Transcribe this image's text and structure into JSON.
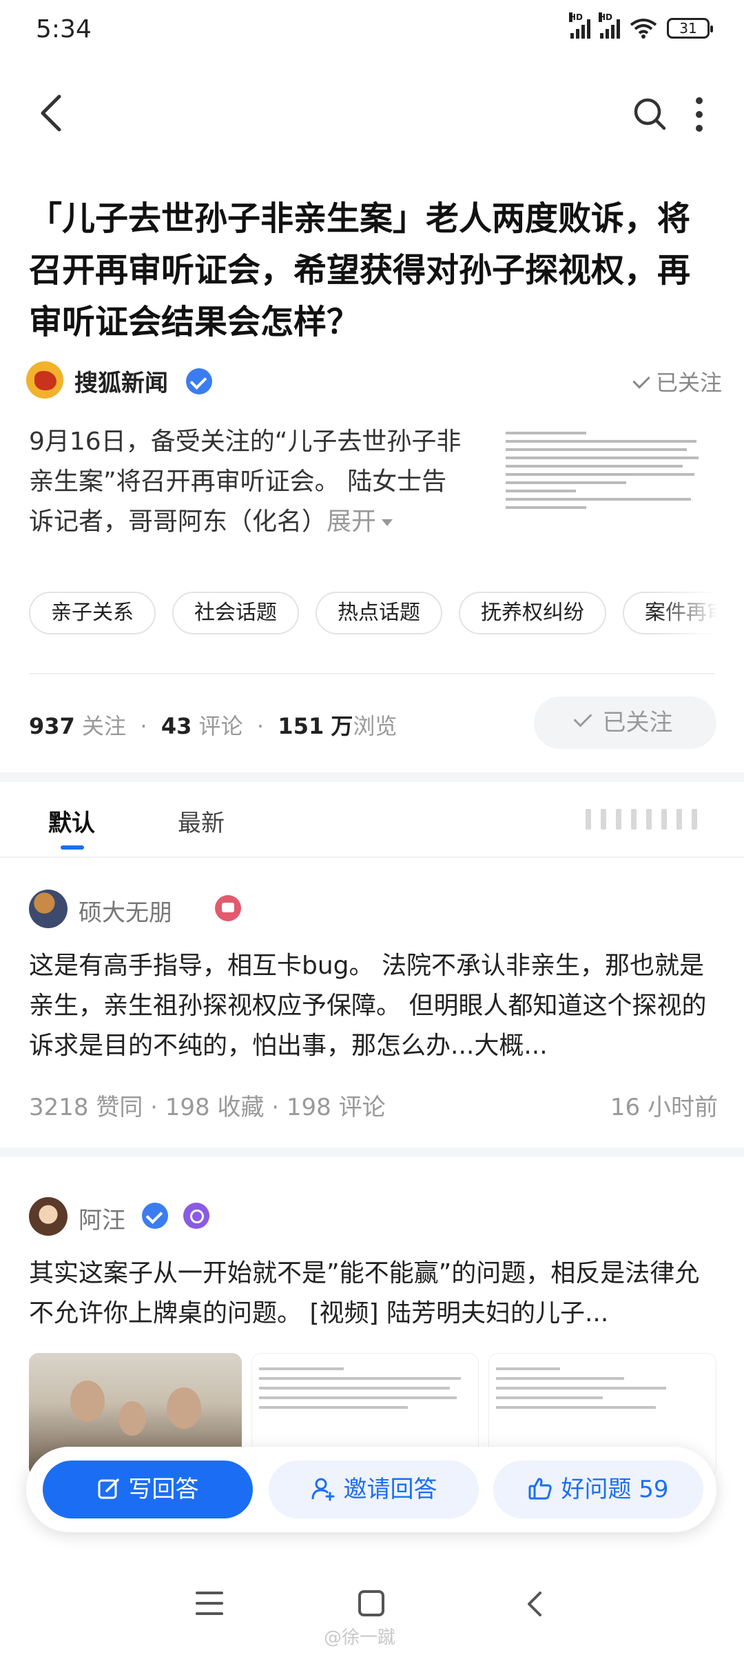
{
  "status_bar": {
    "time": "5:34",
    "signal_label": "HD",
    "battery": "31"
  },
  "title": "「儿子去世孙子非亲生案」老人两度败诉，将召开再审听证会，希望获得对孙子探视权，再审听证会结果会怎样？",
  "source": {
    "name": "搜狐新闻",
    "follow_state": "已关注"
  },
  "summary": {
    "text": "9月16日，备受关注的“儿子去世孙子非亲生案”将召开再审听证会。 陆女士告诉记者，哥哥阿东（化名）",
    "expand": "展开"
  },
  "tags": [
    "亲子关系",
    "社会话题",
    "热点话题",
    "抚养权纠纷",
    "案件再审"
  ],
  "stats": {
    "follow_count": "937",
    "follow_label": "关注",
    "comment_count": "43",
    "comment_label": "评论",
    "view_count": "151",
    "view_unit": "万",
    "view_label": "浏览",
    "follow_button": "已关注"
  },
  "tabs": {
    "default": "默认",
    "latest": "最新"
  },
  "answers": [
    {
      "author": "硕大无朋",
      "text": "这是有高手指导，相互卡bug。 法院不承认非亲生，那也就是亲生，亲生祖孙探视权应予保障。 但明眼人都知道这个探视的诉求是目的不纯的，怕出事，那怎么办...大概...",
      "likes": "3218 赞同",
      "collects": "198 收藏",
      "comments": "198 评论",
      "time": "16 小时前"
    },
    {
      "author": "阿汪",
      "text": "其实这案子从一开始就不是”能不能赢”的问题，相反是法律允不允许你上牌桌的问题。 [视频] 陆芳明夫妇的儿子..."
    }
  ],
  "action_bar": {
    "write": "写回答",
    "invite": "邀请回答",
    "good": "好问题 59"
  },
  "watermark": "@徐一蹴",
  "colors": {
    "accent": "#1b6ef3",
    "verified": "#3b7df0"
  }
}
